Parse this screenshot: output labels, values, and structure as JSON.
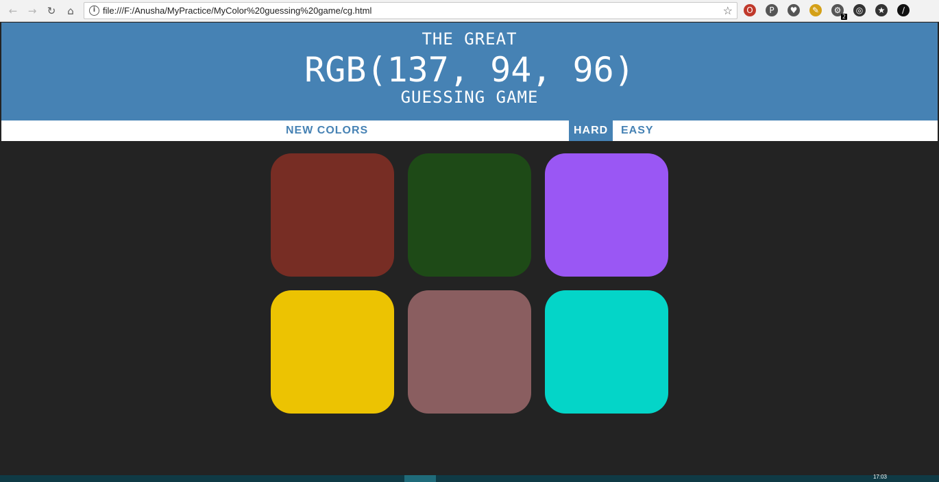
{
  "browser": {
    "url": "file:///F:/Anusha/MyPractice/MyColor%20guessing%20game/cg.html",
    "nav_icons": [
      "back-arrow-icon",
      "forward-arrow-icon",
      "reload-icon",
      "home-icon"
    ],
    "extensions": [
      {
        "name": "opera-icon",
        "color": "#c0392b"
      },
      {
        "name": "pinterest-icon",
        "color": "#555555"
      },
      {
        "name": "pocket-icon",
        "color": "#555555"
      },
      {
        "name": "highlighter-icon",
        "color": "#d4a017"
      },
      {
        "name": "puzzle-extension-icon",
        "color": "#555555",
        "badge": "2"
      },
      {
        "name": "target-icon",
        "color": "#333333"
      },
      {
        "name": "rocket-icon",
        "color": "#333333"
      },
      {
        "name": "eyedropper-icon",
        "color": "#111111"
      }
    ]
  },
  "header": {
    "line1": "THE GREAT",
    "rgb": "RGB(137, 94, 96)",
    "line3": "GUESSING GAME",
    "background": "#4682b4"
  },
  "stripe": {
    "new_colors": "NEW COLORS",
    "message": "",
    "hard": "HARD",
    "easy": "EASY",
    "selected_mode": "hard"
  },
  "squares": [
    {
      "color": "#772d24"
    },
    {
      "color": "#1e4a17"
    },
    {
      "color": "#9a57f4"
    },
    {
      "color": "#ecc302"
    },
    {
      "color": "#8a5e60"
    },
    {
      "color": "#04d5c8"
    }
  ],
  "page_background": "#232323",
  "taskbar": {
    "clock": "17:03"
  }
}
